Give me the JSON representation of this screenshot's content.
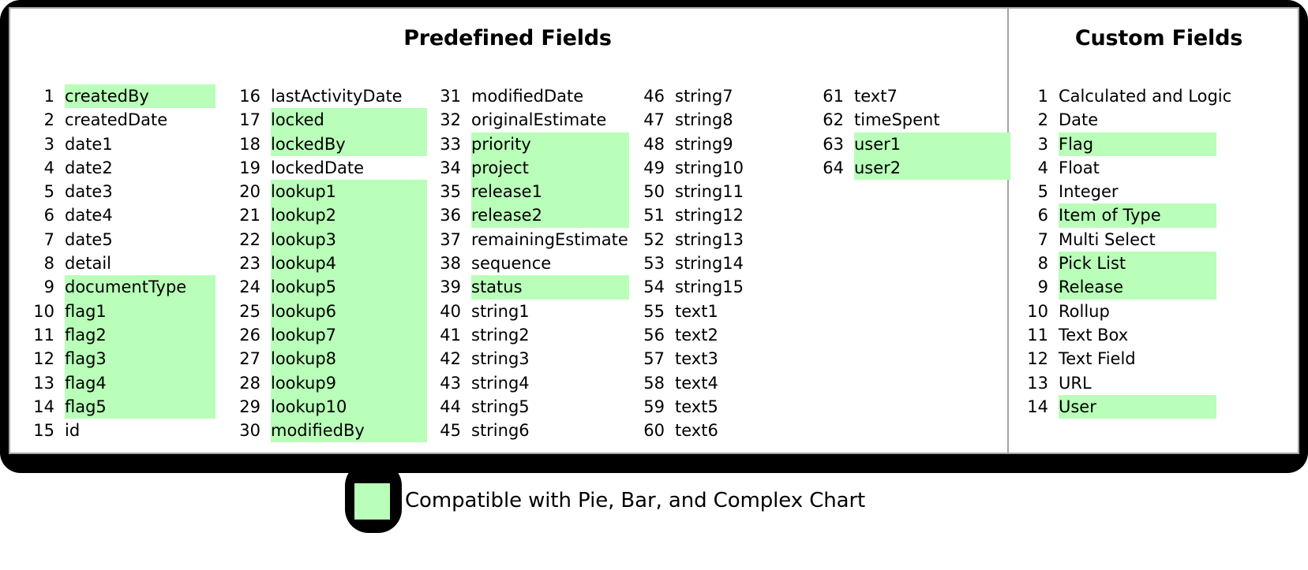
{
  "sections": {
    "predefined": {
      "heading": "Predefined Fields",
      "columns": [
        {
          "id": "col-1",
          "rows": [
            {
              "num": "1",
              "label": "createdBy",
              "highlighted": true
            },
            {
              "num": "2",
              "label": "createdDate",
              "highlighted": false
            },
            {
              "num": "3",
              "label": "date1",
              "highlighted": false
            },
            {
              "num": "4",
              "label": "date2",
              "highlighted": false
            },
            {
              "num": "5",
              "label": "date3",
              "highlighted": false
            },
            {
              "num": "6",
              "label": "date4",
              "highlighted": false
            },
            {
              "num": "7",
              "label": "date5",
              "highlighted": false
            },
            {
              "num": "8",
              "label": "detail",
              "highlighted": false
            },
            {
              "num": "9",
              "label": "documentType",
              "highlighted": true
            },
            {
              "num": "10",
              "label": "flag1",
              "highlighted": true
            },
            {
              "num": "11",
              "label": "flag2",
              "highlighted": true
            },
            {
              "num": "12",
              "label": "flag3",
              "highlighted": true
            },
            {
              "num": "13",
              "label": "flag4",
              "highlighted": true
            },
            {
              "num": "14",
              "label": "flag5",
              "highlighted": true
            },
            {
              "num": "15",
              "label": "id",
              "highlighted": false
            }
          ]
        },
        {
          "id": "col-2",
          "rows": [
            {
              "num": "16",
              "label": "lastActivityDate",
              "highlighted": false
            },
            {
              "num": "17",
              "label": "locked",
              "highlighted": true
            },
            {
              "num": "18",
              "label": "lockedBy",
              "highlighted": true
            },
            {
              "num": "19",
              "label": "lockedDate",
              "highlighted": false
            },
            {
              "num": "20",
              "label": "lookup1",
              "highlighted": true
            },
            {
              "num": "21",
              "label": "lookup2",
              "highlighted": true
            },
            {
              "num": "22",
              "label": "lookup3",
              "highlighted": true
            },
            {
              "num": "23",
              "label": "lookup4",
              "highlighted": true
            },
            {
              "num": "24",
              "label": "lookup5",
              "highlighted": true
            },
            {
              "num": "25",
              "label": "lookup6",
              "highlighted": true
            },
            {
              "num": "26",
              "label": "lookup7",
              "highlighted": true
            },
            {
              "num": "27",
              "label": "lookup8",
              "highlighted": true
            },
            {
              "num": "28",
              "label": "lookup9",
              "highlighted": true
            },
            {
              "num": "29",
              "label": "lookup10",
              "highlighted": true
            },
            {
              "num": "30",
              "label": "modifiedBy",
              "highlighted": true
            }
          ]
        },
        {
          "id": "col-3",
          "rows": [
            {
              "num": "31",
              "label": "modifiedDate",
              "highlighted": false
            },
            {
              "num": "32",
              "label": "originalEstimate",
              "highlighted": false
            },
            {
              "num": "33",
              "label": "priority",
              "highlighted": true
            },
            {
              "num": "34",
              "label": "project",
              "highlighted": true
            },
            {
              "num": "35",
              "label": "release1",
              "highlighted": true
            },
            {
              "num": "36",
              "label": "release2",
              "highlighted": true
            },
            {
              "num": "37",
              "label": "remainingEstimate",
              "highlighted": false
            },
            {
              "num": "38",
              "label": "sequence",
              "highlighted": false
            },
            {
              "num": "39",
              "label": "status",
              "highlighted": true
            },
            {
              "num": "40",
              "label": "string1",
              "highlighted": false
            },
            {
              "num": "41",
              "label": "string2",
              "highlighted": false
            },
            {
              "num": "42",
              "label": "string3",
              "highlighted": false
            },
            {
              "num": "43",
              "label": "string4",
              "highlighted": false
            },
            {
              "num": "44",
              "label": "string5",
              "highlighted": false
            },
            {
              "num": "45",
              "label": "string6",
              "highlighted": false
            }
          ]
        },
        {
          "id": "col-4",
          "rows": [
            {
              "num": "46",
              "label": "string7",
              "highlighted": false
            },
            {
              "num": "47",
              "label": "string8",
              "highlighted": false
            },
            {
              "num": "48",
              "label": "string9",
              "highlighted": false
            },
            {
              "num": "49",
              "label": "string10",
              "highlighted": false
            },
            {
              "num": "50",
              "label": "string11",
              "highlighted": false
            },
            {
              "num": "51",
              "label": "string12",
              "highlighted": false
            },
            {
              "num": "52",
              "label": "string13",
              "highlighted": false
            },
            {
              "num": "53",
              "label": "string14",
              "highlighted": false
            },
            {
              "num": "54",
              "label": "string15",
              "highlighted": false
            },
            {
              "num": "55",
              "label": "text1",
              "highlighted": false
            },
            {
              "num": "56",
              "label": "text2",
              "highlighted": false
            },
            {
              "num": "57",
              "label": "text3",
              "highlighted": false
            },
            {
              "num": "58",
              "label": "text4",
              "highlighted": false
            },
            {
              "num": "59",
              "label": "text5",
              "highlighted": false
            },
            {
              "num": "60",
              "label": "text6",
              "highlighted": false
            }
          ]
        },
        {
          "id": "col-5",
          "rows": [
            {
              "num": "61",
              "label": "text7",
              "highlighted": false
            },
            {
              "num": "62",
              "label": "timeSpent",
              "highlighted": false
            },
            {
              "num": "63",
              "label": "user1",
              "highlighted": true
            },
            {
              "num": "64",
              "label": "user2",
              "highlighted": true
            }
          ]
        }
      ]
    },
    "custom": {
      "heading": "Custom Fields",
      "columns": [
        {
          "id": "col-custom",
          "rows": [
            {
              "num": "1",
              "label": "Calculated and Logic",
              "highlighted": false
            },
            {
              "num": "2",
              "label": "Date",
              "highlighted": false
            },
            {
              "num": "3",
              "label": "Flag",
              "highlighted": true
            },
            {
              "num": "4",
              "label": "Float",
              "highlighted": false
            },
            {
              "num": "5",
              "label": "Integer",
              "highlighted": false
            },
            {
              "num": "6",
              "label": "Item of Type",
              "highlighted": true
            },
            {
              "num": "7",
              "label": "Multi Select",
              "highlighted": false
            },
            {
              "num": "8",
              "label": "Pick List",
              "highlighted": true
            },
            {
              "num": "9",
              "label": "Release",
              "highlighted": true
            },
            {
              "num": "10",
              "label": "Rollup",
              "highlighted": false
            },
            {
              "num": "11",
              "label": "Text Box",
              "highlighted": false
            },
            {
              "num": "12",
              "label": "Text Field",
              "highlighted": false
            },
            {
              "num": "13",
              "label": "URL",
              "highlighted": false
            },
            {
              "num": "14",
              "label": "User",
              "highlighted": true
            }
          ]
        }
      ]
    }
  },
  "legend": {
    "text": "Compatible with Pie, Bar, and Complex Chart",
    "swatch_color": "#b9ffb9"
  },
  "colors": {
    "highlight": "#b9ffb9",
    "frame": "#000000",
    "card_border": "#a6a6a6",
    "text": "#000000"
  }
}
